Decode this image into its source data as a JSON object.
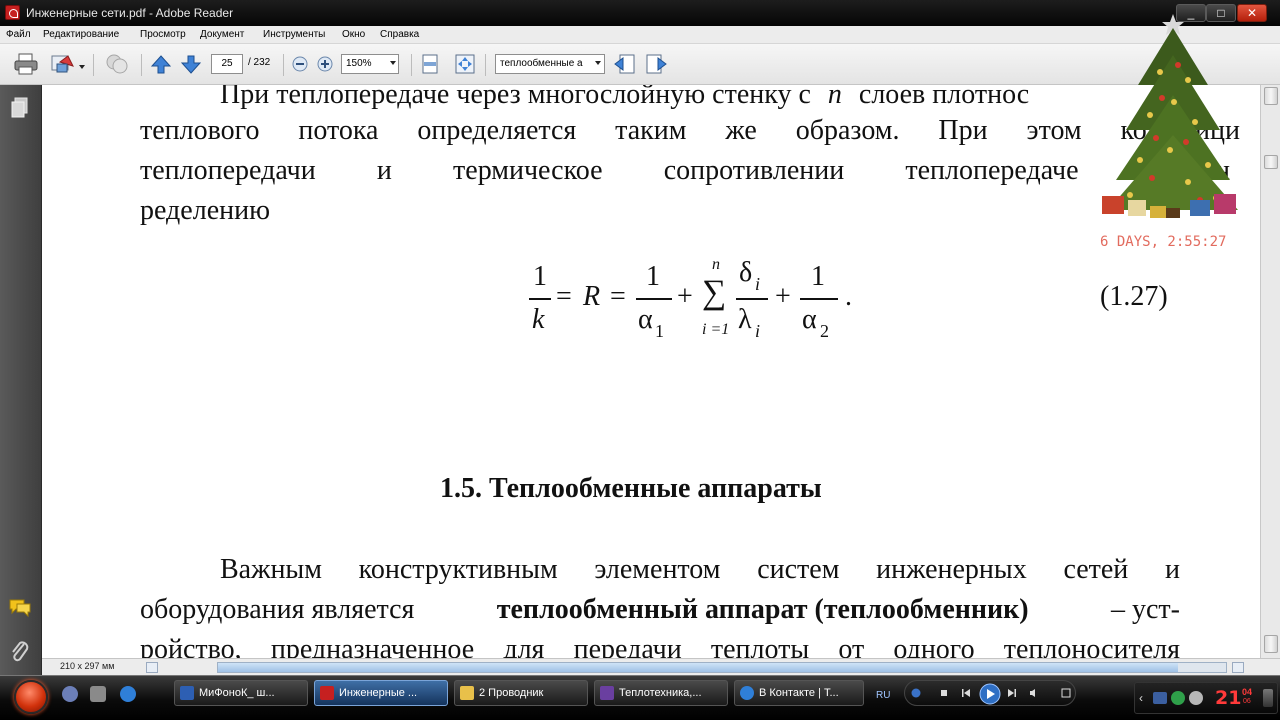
{
  "window": {
    "title": "Инженерные сети.pdf - Adobe Reader",
    "buttons": {
      "minimize": "_",
      "maximize": "□",
      "close": "✕"
    }
  },
  "menu": [
    "Файл",
    "Редактирование",
    "Просмотр",
    "Документ",
    "Инструменты",
    "Окно",
    "Справка"
  ],
  "toolbar": {
    "page_current": "25",
    "page_total": "/ 232",
    "zoom": "150%",
    "search_value": "теплообменные а"
  },
  "document": {
    "para1": [
      "При теплопередаче через многослойную стенку с",
      "n",
      "слоев плотнос",
      "теплового потока определяется таким же образом. При этом коэффици",
      "теплопередачи и термическое сопротивлении теплопередаче согласн",
      "ределению"
    ],
    "formula": {
      "one": "1",
      "k": "k",
      "eq": "=",
      "R": "R",
      "plus": "+",
      "alpha1": "α",
      "sub1": "1",
      "sigma": "∑",
      "upper": "n",
      "lower": "i =1",
      "delta": "δ",
      "lambda": "λ",
      "i": "i",
      "alpha2": "α",
      "sub2": "2",
      "dot": ".",
      "number": "(1.27)"
    },
    "heading": "1.5. Теплообменные аппараты",
    "para2_line1": "Важным конструктивным элементом систем инженерных сетей и",
    "para2_line2_a": "оборудования является",
    "para2_line2_bold": "теплообменный аппарат (теплообменник)",
    "para2_line2_b": "– уст-",
    "para2_line3": "ройство, предназначенное для передачи теплоты от одного теплоносителя"
  },
  "status": {
    "page_size": "210 x 297 мм"
  },
  "gadget": {
    "countdown": "6 DAYS, 2:55:27"
  },
  "taskbar": {
    "tasks": [
      {
        "label": "МиФоноК_ ш...",
        "color": "#2d5fb3"
      },
      {
        "label": "Инженерные ...",
        "color": "#c62020"
      },
      {
        "label": "2 Проводник",
        "color": "#e8c04a"
      },
      {
        "label": "Теплотехника,...",
        "color": "#6a3fa0"
      },
      {
        "label": "В Контакте | Т...",
        "color": "#2f7fd8"
      }
    ],
    "lang": "RU",
    "clock": "21",
    "clock_min": "04",
    "clock_sec": "06"
  }
}
